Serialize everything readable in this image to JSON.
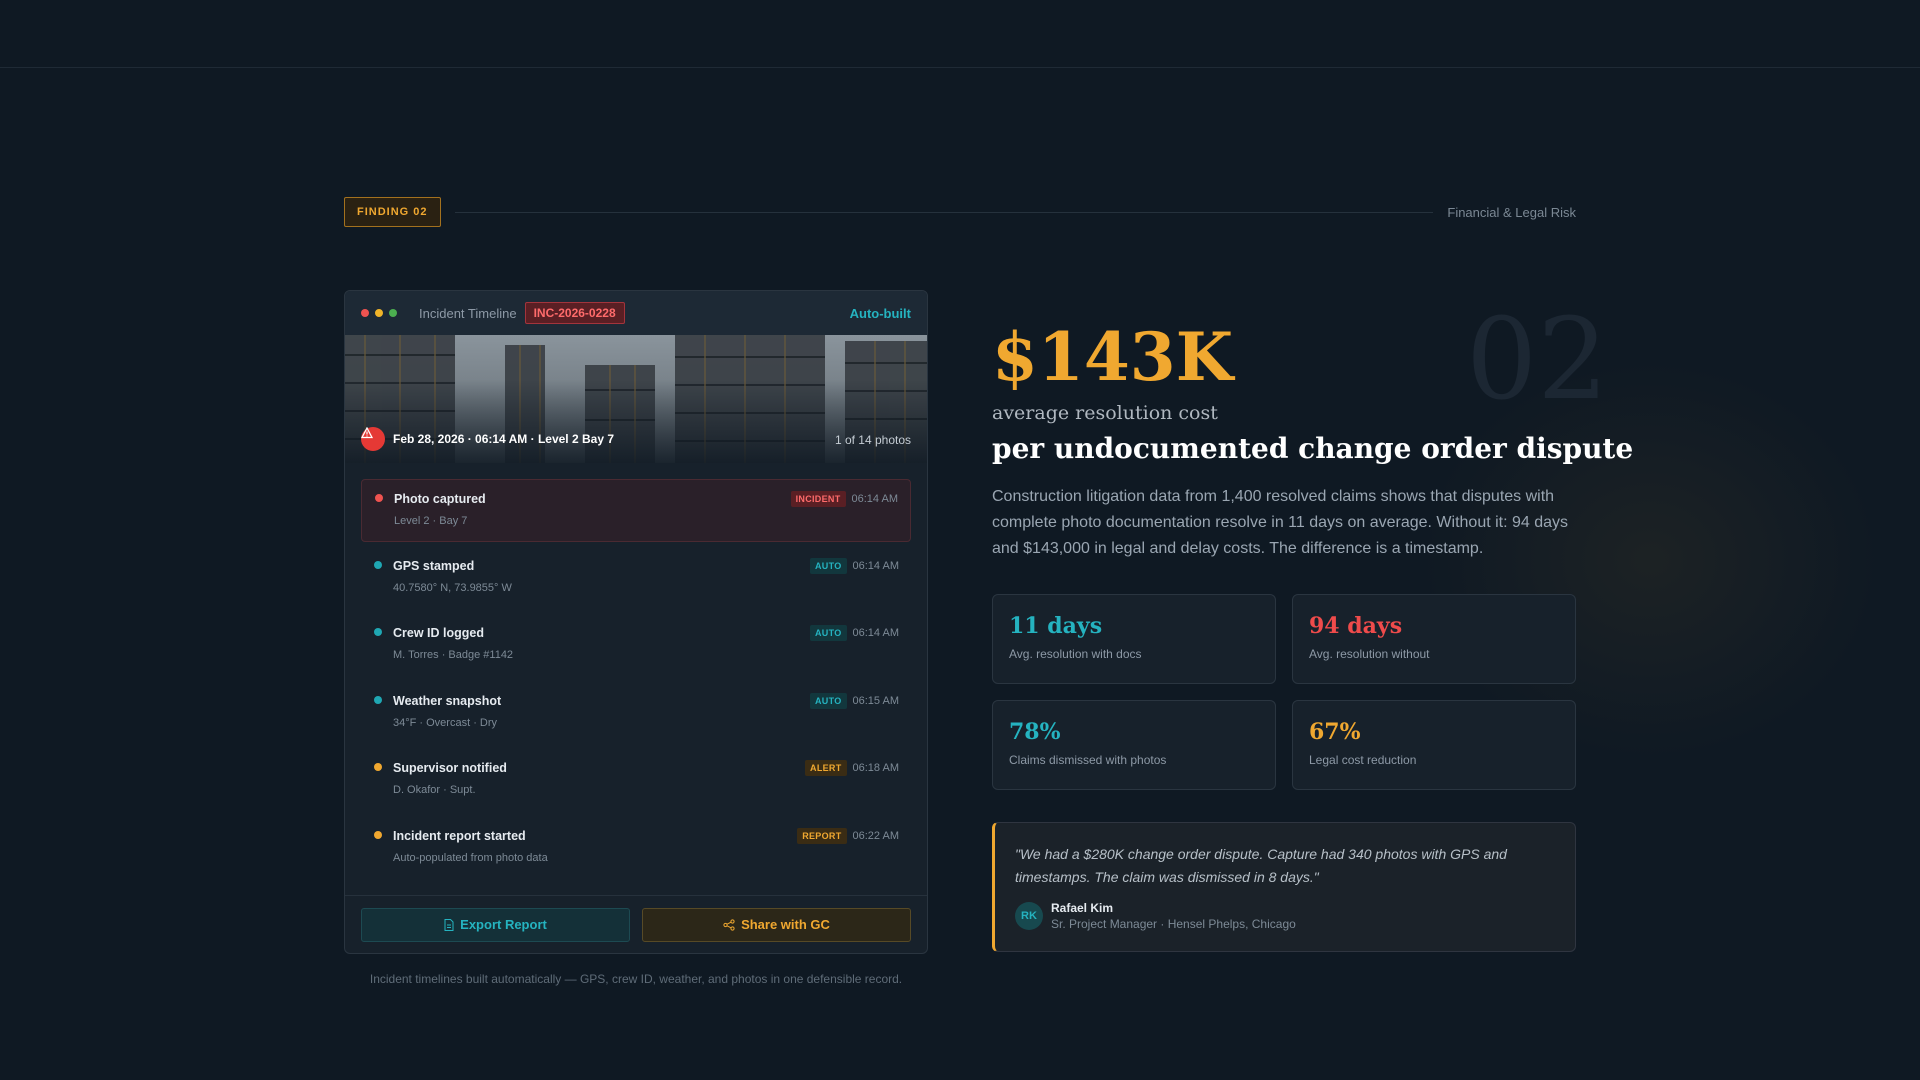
{
  "finding": {
    "badge": "FINDING 02",
    "category": "Financial & Legal Risk"
  },
  "panel": {
    "title": "Incident Timeline",
    "incident_id": "INC-2026-0228",
    "autobuilt": "Auto-built",
    "photo_caption": "Feb 28, 2026 · 06:14 AM · Level 2 Bay 7",
    "photo_count": "1 of 14 photos",
    "events": [
      {
        "title": "Photo captured",
        "sub": "Level 2 · Bay 7",
        "tag": "INCIDENT",
        "time": "06:14 AM",
        "color": "#ef5350"
      },
      {
        "title": "GPS stamped",
        "sub": "40.7580° N, 73.9855° W",
        "tag": "AUTO",
        "time": "06:14 AM",
        "color": "#1fa7b3"
      },
      {
        "title": "Crew ID logged",
        "sub": "M. Torres · Badge #1142",
        "tag": "AUTO",
        "time": "06:14 AM",
        "color": "#1fa7b3"
      },
      {
        "title": "Weather snapshot",
        "sub": "34°F · Overcast · Dry",
        "tag": "AUTO",
        "time": "06:15 AM",
        "color": "#1fa7b3"
      },
      {
        "title": "Supervisor notified",
        "sub": "D. Okafor · Supt.",
        "tag": "ALERT",
        "time": "06:18 AM",
        "color": "#f0a830"
      },
      {
        "title": "Incident report started",
        "sub": "Auto-populated from photo data",
        "tag": "REPORT",
        "time": "06:22 AM",
        "color": "#f0a830"
      }
    ],
    "export_label": "Export Report",
    "share_label": "Share with GC",
    "note": "Incident timelines built automatically — GPS, crew ID, weather, and photos in one defensible record."
  },
  "hero": {
    "bg_number": "02",
    "big_stat": "$143K",
    "stat_label": "average resolution cost",
    "headline": "per undocumented change order dispute",
    "body": "Construction litigation data from 1,400 resolved claims shows that disputes with complete photo documentation resolve in 11 days on average. Without it: 94 days and $143,000 in legal and delay costs. The difference is a timestamp."
  },
  "metrics": [
    {
      "value": "11 days",
      "label": "Avg. resolution with docs",
      "color": "teal"
    },
    {
      "value": "94 days",
      "label": "Avg. resolution without",
      "color": "red"
    },
    {
      "value": "78%",
      "label": "Claims dismissed with photos",
      "color": "teal"
    },
    {
      "value": "67%",
      "label": "Legal cost reduction",
      "color": "amber"
    }
  ],
  "quote": {
    "text": "\"We had a $280K change order dispute. Capture had 340 photos with GPS and timestamps. The claim was dismissed in 8 days.\"",
    "initials": "RK",
    "name": "Rafael Kim",
    "role": "Sr. Project Manager · Hensel Phelps, Chicago"
  }
}
